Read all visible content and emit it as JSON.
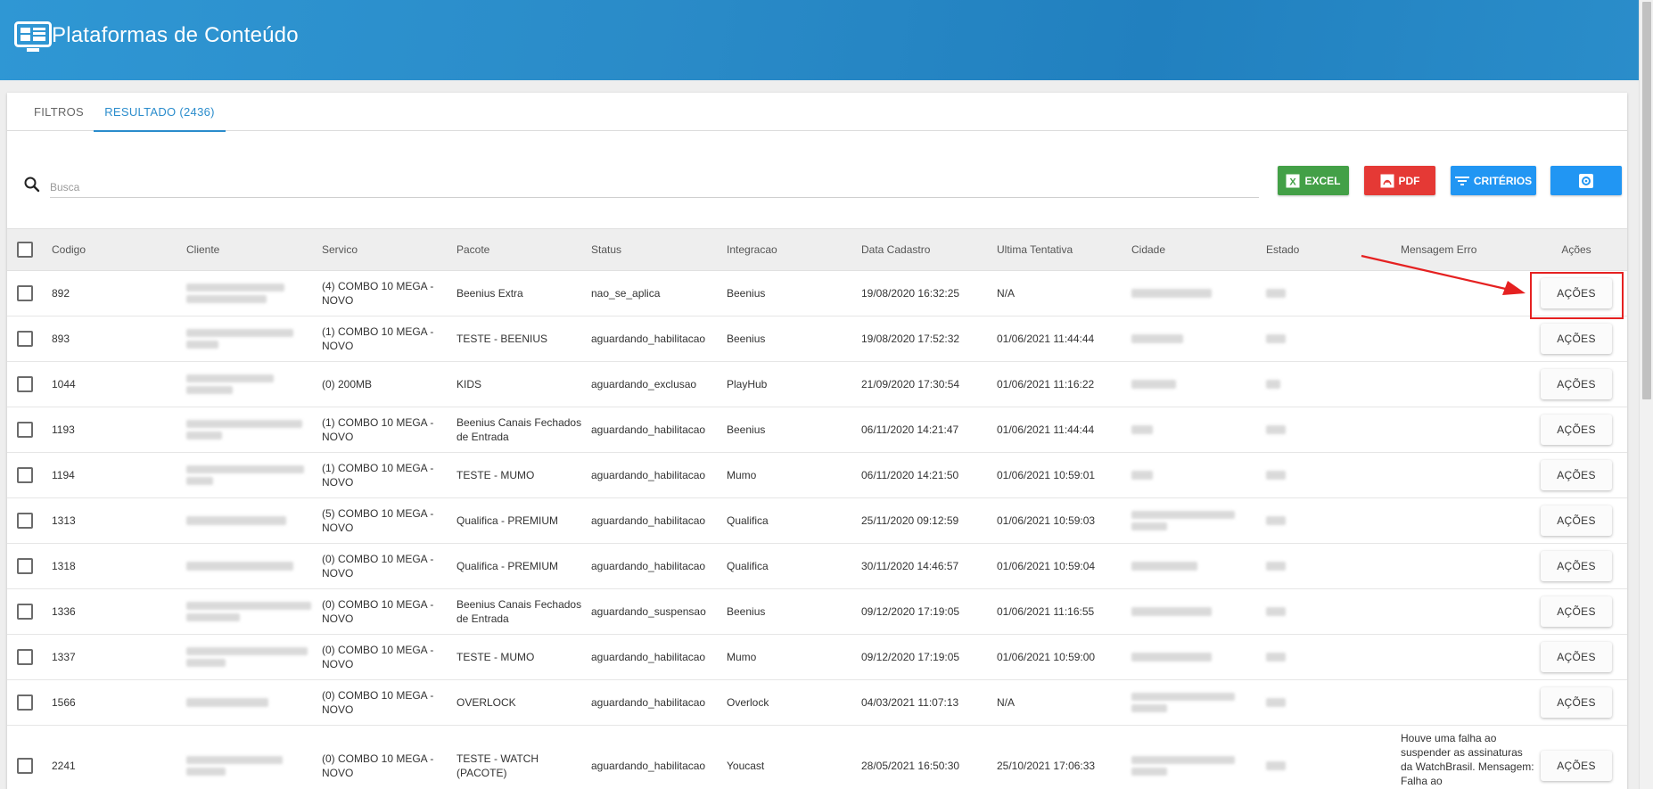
{
  "header": {
    "title": "Plataformas de Conteúdo"
  },
  "tabs": [
    {
      "label": "FILTROS",
      "active": false
    },
    {
      "label": "RESULTADO (2436)",
      "active": true
    }
  ],
  "search": {
    "placeholder": "Busca",
    "value": ""
  },
  "toolbar": {
    "excel_label": "EXCEL",
    "pdf_label": "PDF",
    "criterios_label": "CRITÉRIOS"
  },
  "colors": {
    "header": "#2a8bc8",
    "excel": "#43a047",
    "pdf": "#e53935",
    "primary": "#2196f3",
    "highlight": "#e52121"
  },
  "table": {
    "columns": [
      "Codigo",
      "Cliente",
      "Servico",
      "Pacote",
      "Status",
      "Integracao",
      "Data Cadastro",
      "Ultima Tentativa",
      "Cidade",
      "Estado",
      "Mensagem Erro",
      "Ações"
    ],
    "action_label": "AÇÕES",
    "rows": [
      {
        "codigo": "892",
        "servico": "(4) COMBO 10 MEGA - NOVO",
        "pacote": "Beenius Extra",
        "status": "nao_se_aplica",
        "integracao": "Beenius",
        "data_cadastro": "19/08/2020 16:32:25",
        "ultima_tentativa": "N/A",
        "mensagem_erro": ""
      },
      {
        "codigo": "893",
        "servico": "(1) COMBO 10 MEGA - NOVO",
        "pacote": "TESTE - BEENIUS",
        "status": "aguardando_habilitacao",
        "integracao": "Beenius",
        "data_cadastro": "19/08/2020 17:52:32",
        "ultima_tentativa": "01/06/2021 11:44:44",
        "mensagem_erro": ""
      },
      {
        "codigo": "1044",
        "servico": "(0) 200MB",
        "pacote": "KIDS",
        "status": "aguardando_exclusao",
        "integracao": "PlayHub",
        "data_cadastro": "21/09/2020 17:30:54",
        "ultima_tentativa": "01/06/2021 11:16:22",
        "mensagem_erro": ""
      },
      {
        "codigo": "1193",
        "servico": "(1) COMBO 10 MEGA - NOVO",
        "pacote": "Beenius Canais Fechados de Entrada",
        "status": "aguardando_habilitacao",
        "integracao": "Beenius",
        "data_cadastro": "06/11/2020 14:21:47",
        "ultima_tentativa": "01/06/2021 11:44:44",
        "mensagem_erro": ""
      },
      {
        "codigo": "1194",
        "servico": "(1) COMBO 10 MEGA - NOVO",
        "pacote": "TESTE - MUMO",
        "status": "aguardando_habilitacao",
        "integracao": "Mumo",
        "data_cadastro": "06/11/2020 14:21:50",
        "ultima_tentativa": "01/06/2021 10:59:01",
        "mensagem_erro": ""
      },
      {
        "codigo": "1313",
        "servico": "(5) COMBO 10 MEGA - NOVO",
        "pacote": "Qualifica - PREMIUM",
        "status": "aguardando_habilitacao",
        "integracao": "Qualifica",
        "data_cadastro": "25/11/2020 09:12:59",
        "ultima_tentativa": "01/06/2021 10:59:03",
        "mensagem_erro": ""
      },
      {
        "codigo": "1318",
        "servico": "(0) COMBO 10 MEGA - NOVO",
        "pacote": "Qualifica - PREMIUM",
        "status": "aguardando_habilitacao",
        "integracao": "Qualifica",
        "data_cadastro": "30/11/2020 14:46:57",
        "ultima_tentativa": "01/06/2021 10:59:04",
        "mensagem_erro": ""
      },
      {
        "codigo": "1336",
        "servico": "(0) COMBO 10 MEGA - NOVO",
        "pacote": "Beenius Canais Fechados de Entrada",
        "status": "aguardando_suspensao",
        "integracao": "Beenius",
        "data_cadastro": "09/12/2020 17:19:05",
        "ultima_tentativa": "01/06/2021 11:16:55",
        "mensagem_erro": ""
      },
      {
        "codigo": "1337",
        "servico": "(0) COMBO 10 MEGA - NOVO",
        "pacote": "TESTE - MUMO",
        "status": "aguardando_habilitacao",
        "integracao": "Mumo",
        "data_cadastro": "09/12/2020 17:19:05",
        "ultima_tentativa": "01/06/2021 10:59:00",
        "mensagem_erro": ""
      },
      {
        "codigo": "1566",
        "servico": "(0) COMBO 10 MEGA - NOVO",
        "pacote": "OVERLOCK",
        "status": "aguardando_habilitacao",
        "integracao": "Overlock",
        "data_cadastro": "04/03/2021 11:07:13",
        "ultima_tentativa": "N/A",
        "mensagem_erro": ""
      },
      {
        "codigo": "2241",
        "servico": "(0) COMBO 10 MEGA - NOVO",
        "pacote": "TESTE - WATCH (PACOTE)",
        "status": "aguardando_habilitacao",
        "integracao": "Youcast",
        "data_cadastro": "28/05/2021 16:50:30",
        "ultima_tentativa": "25/10/2021 17:06:33",
        "mensagem_erro": "Houve uma falha ao suspender as assinaturas da WatchBrasil. Mensagem: Falha ao"
      }
    ]
  }
}
